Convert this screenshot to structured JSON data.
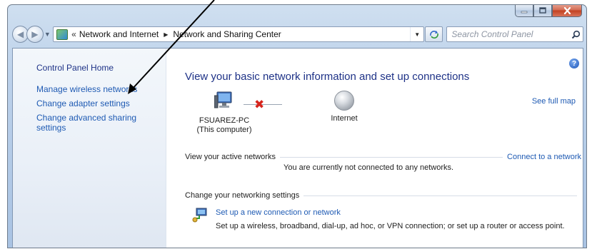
{
  "window": {
    "controls": {
      "minimize_icon": "minimize-icon",
      "maximize_icon": "maximize-icon",
      "close_icon": "close-icon"
    }
  },
  "address_bar": {
    "overflow_chevron": "«",
    "breadcrumb": [
      "Network and Internet",
      "Network and Sharing Center"
    ],
    "search_placeholder": "Search Control Panel"
  },
  "sidebar": {
    "home_label": "Control Panel Home",
    "links": [
      "Manage wireless networks",
      "Change adapter settings",
      "Change advanced sharing settings"
    ]
  },
  "main": {
    "title": "View your basic network information and set up connections",
    "see_full_map": "See full map",
    "map": {
      "computer_name": "FSUAREZ-PC",
      "computer_caption": "(This computer)",
      "internet_label": "Internet",
      "connection_status_icon": "disconnected-x-icon"
    },
    "active_networks": {
      "header": "View your active networks",
      "connect_link": "Connect to a network",
      "message": "You are currently not connected to any networks."
    },
    "change_settings": {
      "header": "Change your networking settings",
      "task_link": "Set up a new connection or network",
      "task_description": "Set up a wireless, broadband, dial-up, ad hoc, or VPN connection; or set up a router or access point."
    }
  },
  "colors": {
    "link": "#1e5ab3",
    "title": "#1e3287",
    "disconnected": "#d6241c",
    "close_button": "#c2401f"
  }
}
